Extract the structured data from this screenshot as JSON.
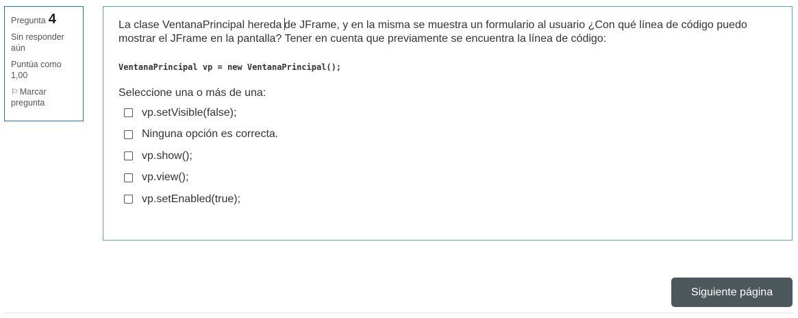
{
  "info": {
    "question_label": "Pregunta",
    "question_number": "4",
    "state": "Sin responder aún",
    "grade": "Puntúa como 1,00",
    "flag_label": "Marcar pregunta",
    "flag_icon": "flag-icon"
  },
  "question": {
    "text_before_cursor": "La clase VentanaPrincipal hereda ",
    "text_after_cursor": "de JFrame, y en la misma se muestra un formulario al usuario ¿Con qué línea de código puedo mostrar el JFrame en la pantalla? Tener en cuenta que previamente se encuentra la línea de código:",
    "code": "VentanaPrincipal vp = new VentanaPrincipal();",
    "prompt": "Seleccione una o más de una:",
    "answers": [
      "vp.setVisible(false);",
      "Ninguna opción es correcta.",
      "vp.show();",
      "vp.view();",
      "vp.setEnabled(true);"
    ]
  },
  "navigation": {
    "next_label": "Siguiente página"
  },
  "colors": {
    "panel_border": "#5a9fcf",
    "info_border": "#1a74b6",
    "button_bg": "#4d585c"
  }
}
